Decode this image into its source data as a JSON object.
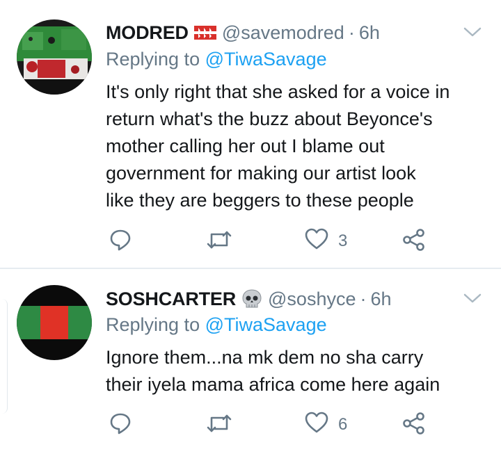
{
  "tweets": [
    {
      "name": "MODRED",
      "badge_icon": "red-flag-emoji",
      "handle": "@savemodred",
      "separator": "·",
      "time": "6h",
      "replying_prefix": "Replying to",
      "replying_to": "@TiwaSavage",
      "body_lines": [
        "It's only right that she asked for a voice in",
        "return what's the buzz about Beyonce's",
        "mother calling her out I blame out",
        "government for making our artist look",
        "like they are beggers to these people"
      ],
      "likes": "3"
    },
    {
      "name": "SOSHCARTER",
      "badge_icon": "skull-emoji",
      "handle": "@soshyce",
      "separator": "·",
      "time": "6h",
      "replying_prefix": "Replying to",
      "replying_to": "@TiwaSavage",
      "body_lines": [
        "Ignore them...na mk dem no sha carry",
        "their iyela mama africa come here again"
      ],
      "likes": "6"
    }
  ],
  "colors": {
    "text": "#14171a",
    "secondary": "#657786",
    "accent": "#1da1f2",
    "divider": "#e6ecf0"
  }
}
